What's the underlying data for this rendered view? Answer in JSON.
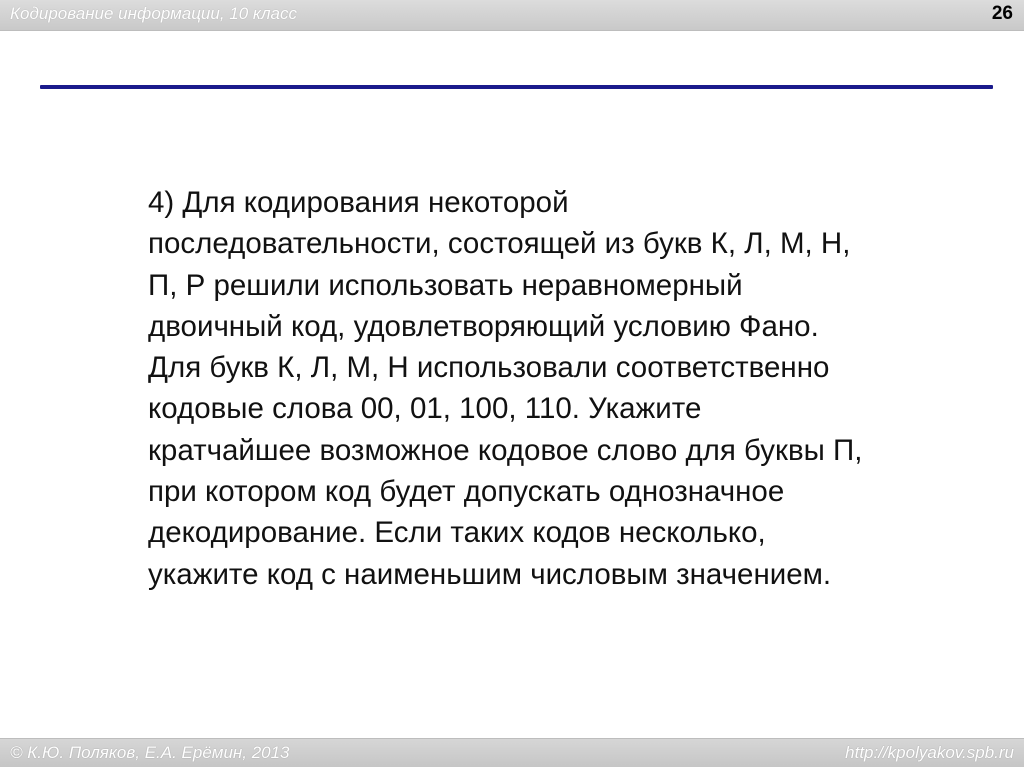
{
  "header": {
    "title": "Кодирование информации, 10 класс",
    "slide_number": "26"
  },
  "main": {
    "text": "4) Для кодирования некоторой\nпоследовательности, состоящей из букв К, Л, М, Н,\nП, Р решили использовать неравномерный\nдвоичный код, удовлетворяющий условию Фано.\nДля букв К, Л, М, Н использовали соответственно\nкодовые слова 00, 01, 100, 110. Укажите\nкратчайшее возможное кодовое слово для буквы П,\nпри котором код будет допускать однозначное\nдекодирование. Если таких кодов несколько,\nукажите код с наименьшим числовым значением."
  },
  "footer": {
    "copyright": "© К.Ю. Поляков, Е.А. Ерёмин, 2013",
    "url": "http://kpolyakov.spb.ru"
  },
  "colors": {
    "rule": "#1a1a8c",
    "header_band": "#d0d0d0",
    "footer_band": "#cecece"
  }
}
